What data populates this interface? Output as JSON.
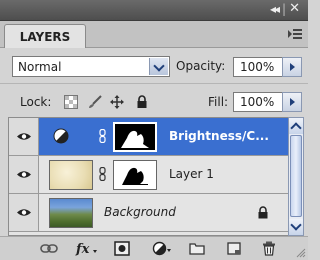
{
  "panel": {
    "title": "LAYERS",
    "collapse_glyph": "◂◂",
    "close_glyph": "✕"
  },
  "controls": {
    "blend_mode": "Normal",
    "opacity_label": "Opacity:",
    "opacity_value": "100%",
    "lock_label": "Lock:",
    "fill_label": "Fill:",
    "fill_value": "100%"
  },
  "layers": [
    {
      "name": "Brightness/C...",
      "selected": true,
      "visible": true,
      "type": "adjustment"
    },
    {
      "name": "Layer 1",
      "selected": false,
      "visible": true,
      "type": "pixel"
    },
    {
      "name": "Background",
      "selected": false,
      "visible": true,
      "type": "background",
      "locked": true
    }
  ],
  "colors": {
    "selection": "#3a6fd0",
    "panel_bg": "#d4d4d4",
    "title_bar": "#555555"
  },
  "icons": {
    "bottom": [
      "link-layers-icon",
      "layer-style-fx-icon",
      "add-mask-icon",
      "adjustment-layer-icon",
      "new-group-icon",
      "new-layer-icon",
      "delete-layer-icon"
    ],
    "lock": [
      "lock-transparent-icon",
      "lock-paint-icon",
      "lock-move-icon",
      "lock-all-icon"
    ]
  }
}
